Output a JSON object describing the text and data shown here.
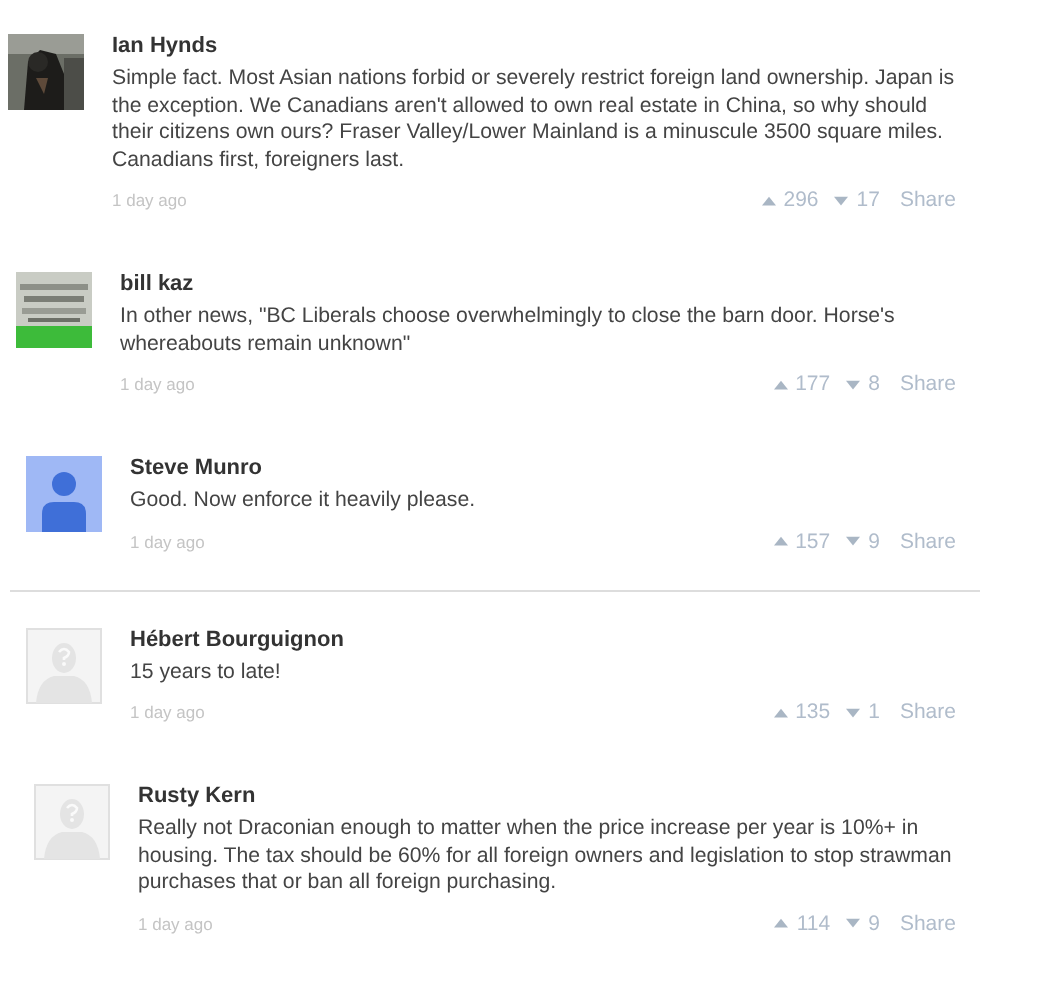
{
  "comments": [
    {
      "author": "Ian Hynds",
      "divider_above": false,
      "text": "Simple fact. Most Asian nations forbid or severely restrict foreign land ownership. Japan is the exception. We Canadians aren't allowed to own real estate in China, so why should their citizens own ours? Fraser Valley/Lower Mainland is a minuscule 3500 square miles. Canadians first, foreigners last.",
      "time": "1 day ago",
      "upvotes": "296",
      "downvotes": "17",
      "share": "Share"
    },
    {
      "author": "bill kaz",
      "divider_above": false,
      "text": "In other news, \"BC Liberals choose overwhelmingly to close the barn door. Horse's whereabouts remain unknown\"",
      "time": "1 day ago",
      "upvotes": "177",
      "downvotes": "8",
      "share": "Share"
    },
    {
      "author": "Steve Munro",
      "avatar": {
        "kind": "person"
      },
      "divider_above": false,
      "text": "Good. Now enforce it heavily please.",
      "time": "1 day ago",
      "upvotes": "157",
      "downvotes": "9",
      "share": "Share"
    },
    {
      "author": "Hébert Bourguignon",
      "avatar": {
        "kind": "unknown"
      },
      "divider_above": true,
      "text": "15 years to late!",
      "time": "1 day ago",
      "upvotes": "135",
      "downvotes": "1",
      "share": "Share"
    },
    {
      "author": "Rusty Kern",
      "avatar": {
        "kind": "unknown"
      },
      "divider_above": false,
      "text": "Really not Draconian enough to matter when the price increase per year is 10%+ in housing. The tax should be 60% for all foreign owners and legislation to stop strawman purchases that or ban all foreign purchasing.",
      "time": "1 day ago",
      "upvotes": "114",
      "downvotes": "9",
      "share": "Share"
    }
  ]
}
